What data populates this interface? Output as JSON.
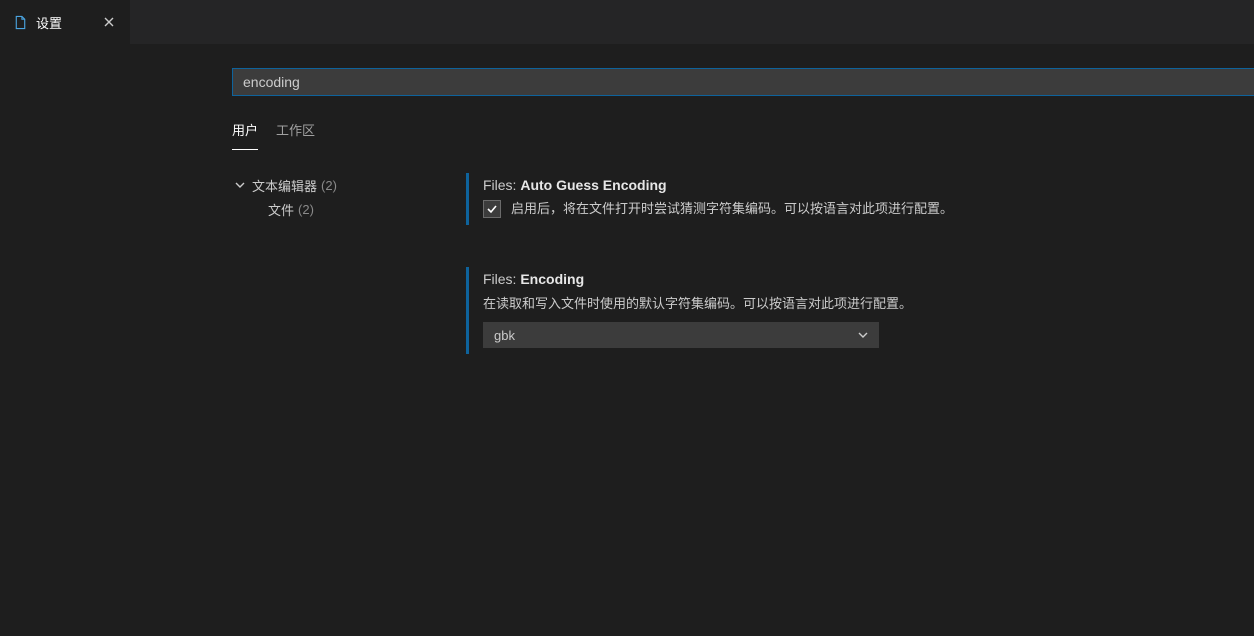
{
  "tab": {
    "title": "设置"
  },
  "search": {
    "value": "encoding"
  },
  "scope": {
    "user": "用户",
    "workspace": "工作区"
  },
  "tree": {
    "textEditor": "文本编辑器",
    "textEditorCount": "(2)",
    "files": "文件",
    "filesCount": "(2)"
  },
  "settings": {
    "autoGuess": {
      "prefix": "Files: ",
      "name": "Auto Guess Encoding",
      "desc": "启用后，将在文件打开时尝试猜测字符集编码。可以按语言对此项进行配置。"
    },
    "encoding": {
      "prefix": "Files: ",
      "name": "Encoding",
      "desc": "在读取和写入文件时使用的默认字符集编码。可以按语言对此项进行配置。",
      "value": "gbk"
    }
  }
}
